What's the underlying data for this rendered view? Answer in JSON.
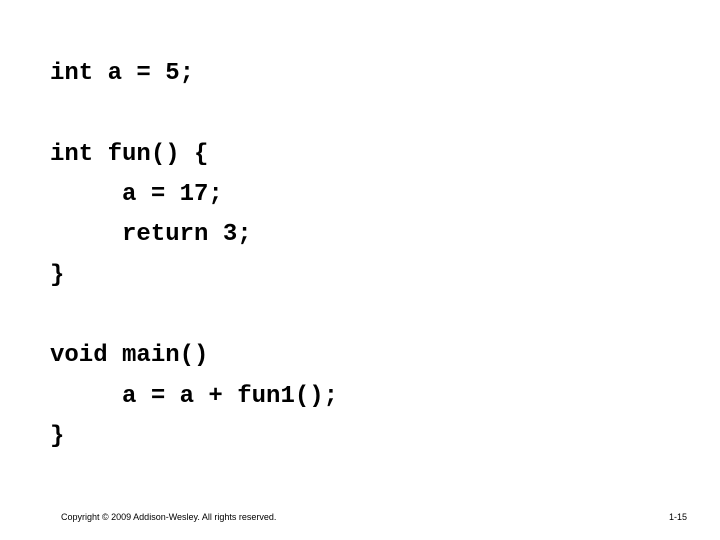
{
  "code": {
    "lines": [
      "int a = 5;",
      "int fun() {",
      "     a = 17;",
      "     return 3;",
      "}",
      "void main()",
      "     a = a + fun1();",
      "}"
    ]
  },
  "footer": {
    "copyright": "Copyright © 2009 Addison-Wesley. All rights reserved.",
    "page_number": "1-15"
  }
}
